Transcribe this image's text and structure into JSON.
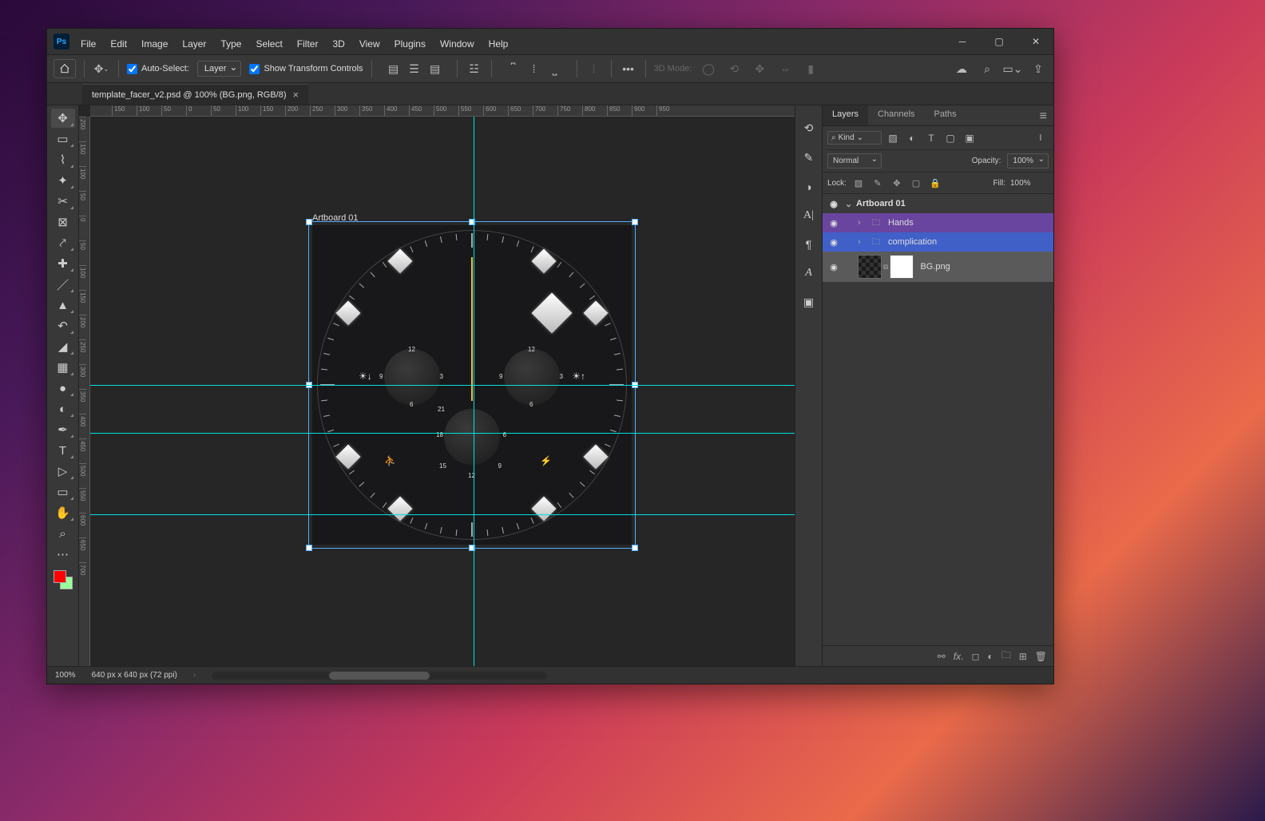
{
  "menubar": [
    "File",
    "Edit",
    "Image",
    "Layer",
    "Type",
    "Select",
    "Filter",
    "3D",
    "View",
    "Plugins",
    "Window",
    "Help"
  ],
  "options": {
    "auto_select": "Auto-Select:",
    "layer_dd": "Layer",
    "show_transform": "Show Transform Controls",
    "mode_3d": "3D Mode:"
  },
  "document": {
    "tab_title": "template_facer_v2.psd @ 100% (BG.png, RGB/8)",
    "artboard_label": "Artboard 01"
  },
  "ruler_h": [
    "150",
    "100",
    "50",
    "0",
    "50",
    "100",
    "150",
    "200",
    "250",
    "300",
    "350",
    "400",
    "450",
    "500",
    "550",
    "600",
    "650",
    "700",
    "750",
    "800",
    "850",
    "900",
    "950"
  ],
  "ruler_v": [
    "200",
    "150",
    "100",
    "50",
    "0",
    "50",
    "100",
    "150",
    "200",
    "250",
    "300",
    "350",
    "400",
    "450",
    "500",
    "550",
    "600",
    "650",
    "700"
  ],
  "panels": {
    "tabs": [
      "Layers",
      "Channels",
      "Paths"
    ],
    "kind": "Kind",
    "blend_mode": "Normal",
    "opacity_label": "Opacity:",
    "opacity_val": "100%",
    "lock_label": "Lock:",
    "fill_label": "Fill:",
    "fill_val": "100%"
  },
  "layers": {
    "artboard": "Artboard 01",
    "hands": "Hands",
    "complication": "complication",
    "bg": "BG.png"
  },
  "subdial": {
    "n12": "12",
    "n3": "3",
    "n6": "6",
    "n9": "9",
    "n15": "15",
    "n18": "18",
    "n21": "21"
  },
  "status": {
    "zoom": "100%",
    "dims": "640 px x 640 px (72 ppi)"
  }
}
